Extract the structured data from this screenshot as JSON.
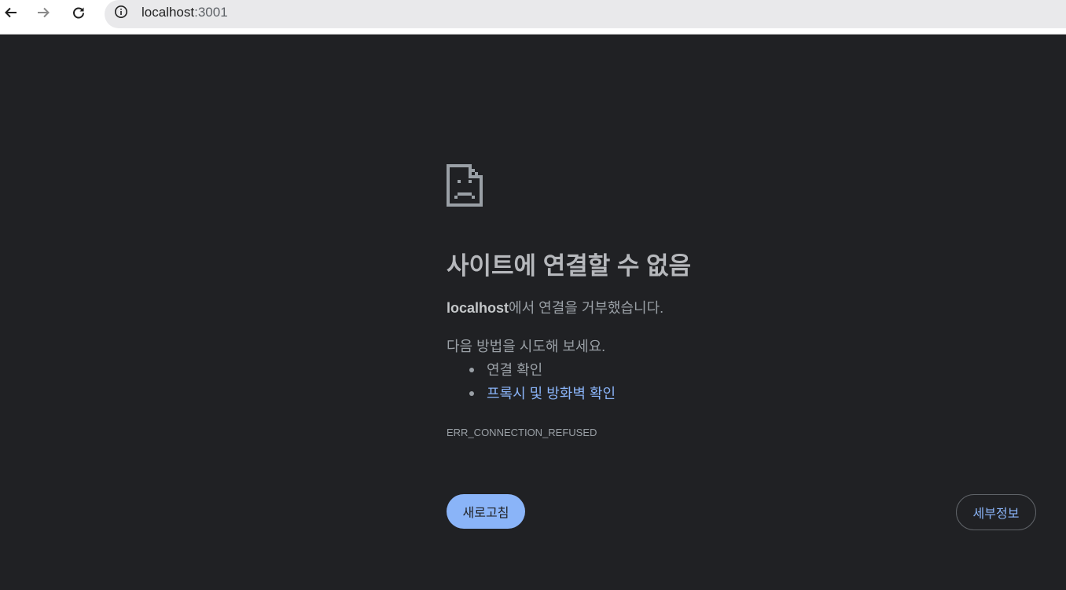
{
  "browser": {
    "back_icon": "arrow-left-icon",
    "forward_icon": "arrow-right-icon",
    "reload_icon": "reload-icon",
    "site_info_icon": "info-icon",
    "url_host": "localhost",
    "url_port": ":3001"
  },
  "error_page": {
    "icon": "sad-file-icon",
    "title": "사이트에 연결할 수 없음",
    "summary_host": "localhost",
    "summary_rest": "에서 연결을 거부했습니다.",
    "suggestions_heading": "다음 방법을 시도해 보세요.",
    "suggestions": [
      {
        "label": "연결 확인"
      },
      {
        "label": "프록시 및 방화벽 확인"
      }
    ],
    "error_code": "ERR_CONNECTION_REFUSED",
    "reload_label": "새로고침",
    "details_label": "세부정보"
  },
  "colors": {
    "page_background": "#202124",
    "link": "#8ab4f8",
    "primary_button": "#8ab4f8",
    "text": "#9aa0a6"
  }
}
